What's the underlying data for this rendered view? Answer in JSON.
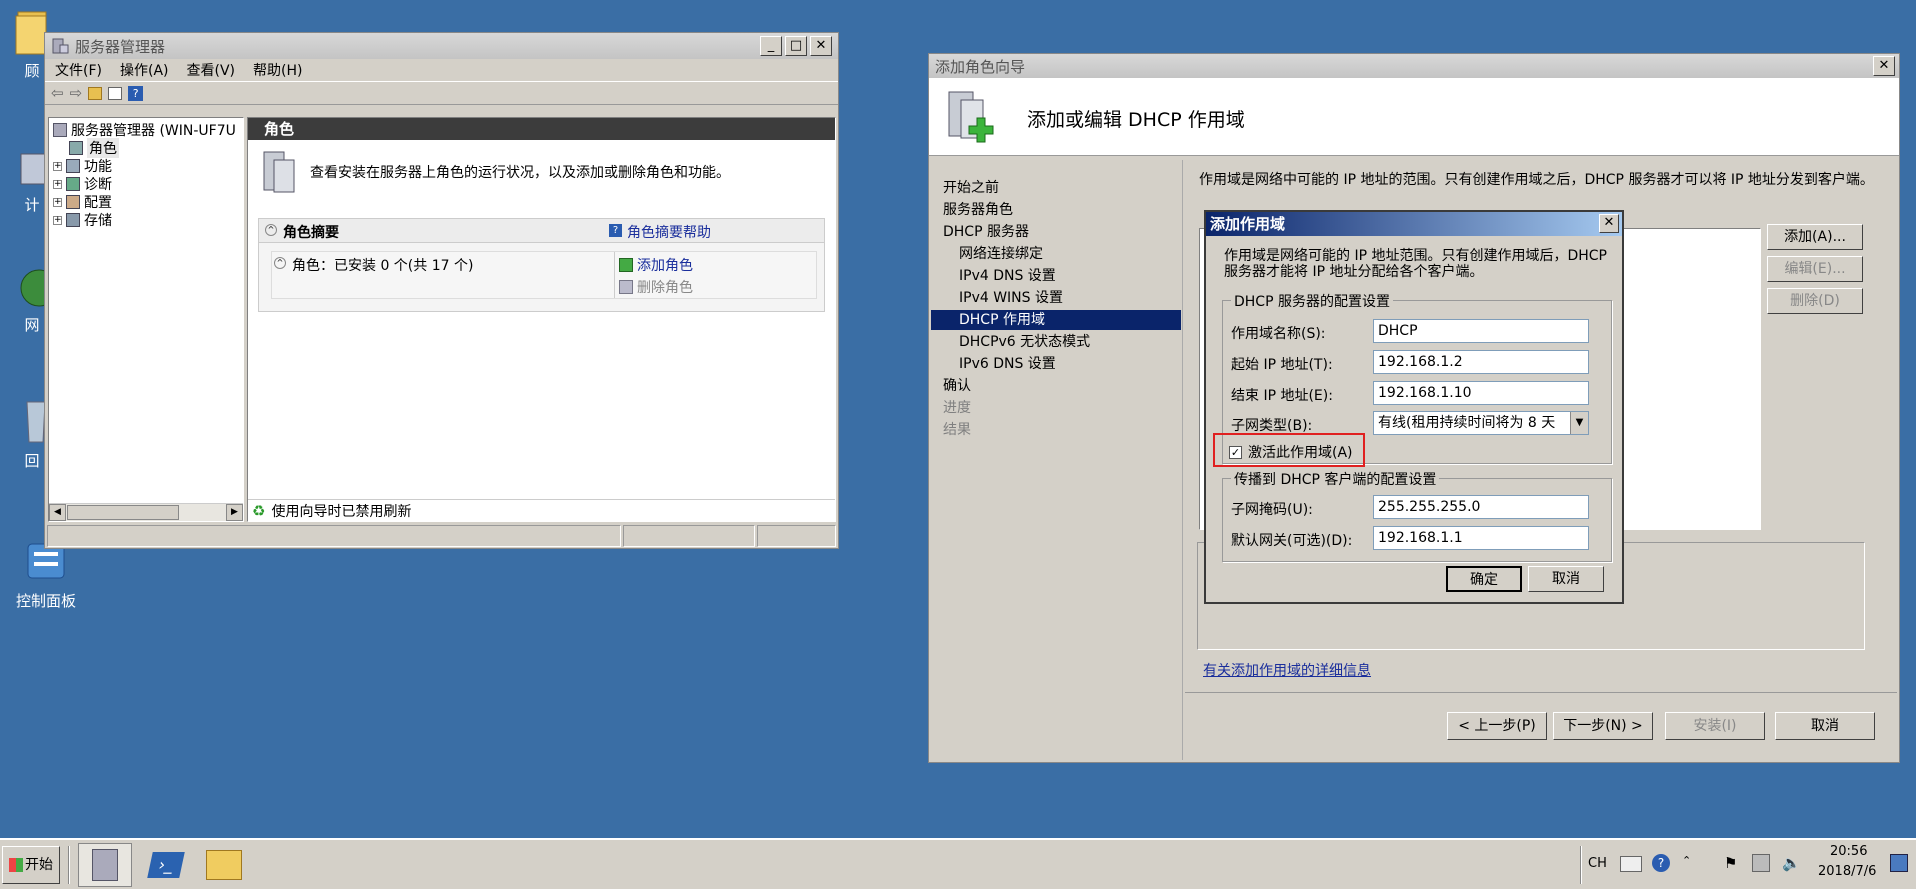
{
  "desktop": {
    "icons": [
      "顾",
      "计",
      "网",
      "回",
      "控制面板"
    ]
  },
  "server_manager": {
    "title": "服务器管理器",
    "menu": [
      "文件(F)",
      "操作(A)",
      "查看(V)",
      "帮助(H)"
    ],
    "tree": {
      "root": "服务器管理器 (WIN-UF7U",
      "items": [
        "角色",
        "功能",
        "诊断",
        "配置",
        "存储"
      ]
    },
    "header": "角色",
    "description": "查看安装在服务器上角色的运行状况，以及添加或删除角色和功能。",
    "summary_title": "角色摘要",
    "summary_help": "角色摘要帮助",
    "roles_status": "角色：已安装 0 个(共 17 个)",
    "add_role": "添加角色",
    "remove_role": "删除角色",
    "refresh_status": "使用向导时已禁用刷新"
  },
  "wizard": {
    "title": "添加角色向导",
    "heading": "添加或编辑 DHCP 作用域",
    "nav": [
      {
        "label": "开始之前",
        "level": 0,
        "state": "normal"
      },
      {
        "label": "服务器角色",
        "level": 0,
        "state": "normal"
      },
      {
        "label": "DHCP 服务器",
        "level": 0,
        "state": "normal"
      },
      {
        "label": "网络连接绑定",
        "level": 1,
        "state": "normal"
      },
      {
        "label": "IPv4 DNS 设置",
        "level": 1,
        "state": "normal"
      },
      {
        "label": "IPv4 WINS 设置",
        "level": 1,
        "state": "normal"
      },
      {
        "label": "DHCP 作用域",
        "level": 1,
        "state": "selected"
      },
      {
        "label": "DHCPv6 无状态模式",
        "level": 1,
        "state": "normal"
      },
      {
        "label": "IPv6 DNS 设置",
        "level": 1,
        "state": "normal"
      },
      {
        "label": "确认",
        "level": 0,
        "state": "normal"
      },
      {
        "label": "进度",
        "level": 0,
        "state": "disabled"
      },
      {
        "label": "结果",
        "level": 0,
        "state": "disabled"
      }
    ],
    "intro": "作用域是网络中可能的 IP 地址的范围。只有创建作用域之后，DHCP 服务器才可以将 IP 地址分发到客户端。",
    "list_label_partial": "作用域(C)",
    "add_button": "添加(A)...",
    "edit_button": "编辑(E)...",
    "delete_button": "删除(D)",
    "more_info_link": "有关添加作用域的详细信息",
    "prev_button": "< 上一步(P)",
    "next_button": "下一步(N) >",
    "install_button": "安装(I)",
    "cancel_button": "取消"
  },
  "scope_dialog": {
    "title": "添加作用域",
    "intro": "作用域是网络可能的 IP 地址范围。只有创建作用域后，DHCP 服务器才能将 IP 地址分配给各个客户端。",
    "group1_title": "DHCP 服务器的配置设置",
    "scope_name_label": "作用域名称(S):",
    "scope_name_value": "DHCP",
    "start_ip_label": "起始 IP 地址(T):",
    "start_ip_value": "192.168.1.2",
    "end_ip_label": "结束 IP 地址(E):",
    "end_ip_value": "192.168.1.10",
    "subnet_type_label": "子网类型(B):",
    "subnet_type_value": "有线(租用持续时间将为 8 天",
    "activate_label": "激活此作用域(A)",
    "activate_checked": true,
    "group2_title": "传播到 DHCP 客户端的配置设置",
    "subnet_mask_label": "子网掩码(U):",
    "subnet_mask_value": "255.255.255.0",
    "gateway_label": "默认网关(可选)(D):",
    "gateway_value": "192.168.1.1",
    "ok_button": "确定",
    "cancel_button": "取消",
    "highlight_color": "#e02020"
  },
  "taskbar": {
    "start_label": "开始",
    "lang": "CH",
    "time": "20:56",
    "date": "2018/7/6"
  }
}
